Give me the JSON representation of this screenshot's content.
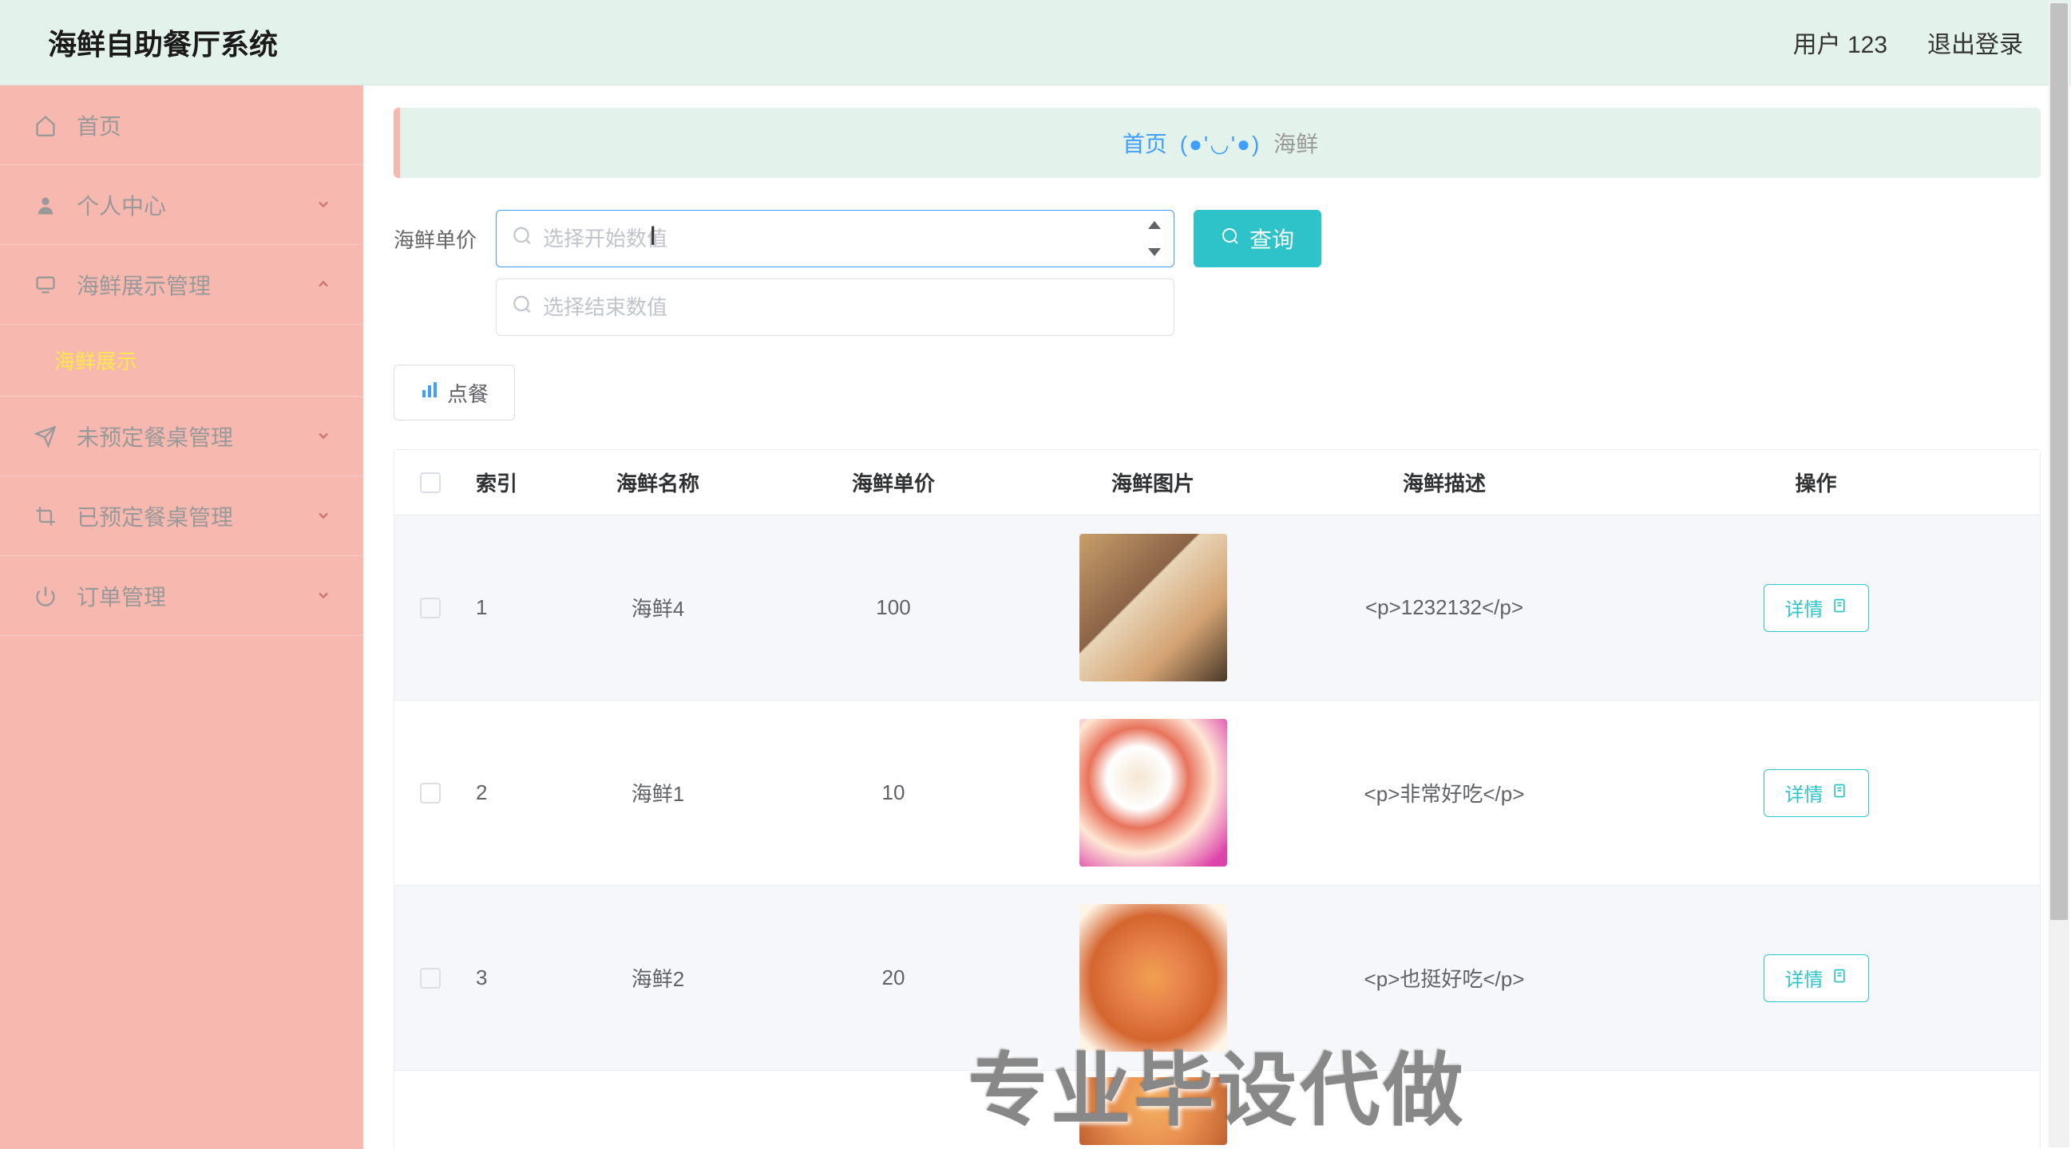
{
  "header": {
    "title": "海鲜自助餐厅系统",
    "user_label": "用户 123",
    "logout_label": "退出登录"
  },
  "sidebar": {
    "items": [
      {
        "label": "首页",
        "icon": "home-icon",
        "expandable": false
      },
      {
        "label": "个人中心",
        "icon": "user-icon",
        "expandable": true
      },
      {
        "label": "海鲜展示管理",
        "icon": "display-icon",
        "expandable": true,
        "expanded": true
      },
      {
        "label": "未预定餐桌管理",
        "icon": "plane-icon",
        "expandable": true
      },
      {
        "label": "已预定餐桌管理",
        "icon": "crop-icon",
        "expandable": true
      },
      {
        "label": "订单管理",
        "icon": "power-icon",
        "expandable": true
      }
    ],
    "sub_item": "海鲜展示"
  },
  "breadcrumb": {
    "home": "首页",
    "sep": "(●'◡'●)",
    "current": "海鲜"
  },
  "search": {
    "label": "海鲜单价",
    "start_placeholder": "选择开始数值",
    "end_placeholder": "选择结束数值",
    "query_label": "查询"
  },
  "actions": {
    "order_label": "点餐"
  },
  "table": {
    "headers": {
      "idx": "索引",
      "name": "海鲜名称",
      "price": "海鲜单价",
      "img": "海鲜图片",
      "desc": "海鲜描述",
      "op": "操作"
    },
    "detail_label": "详情",
    "rows": [
      {
        "idx": "1",
        "name": "海鲜4",
        "price": "100",
        "desc": "<p>1232132</p>"
      },
      {
        "idx": "2",
        "name": "海鲜1",
        "price": "10",
        "desc": "<p>非常好吃</p>"
      },
      {
        "idx": "3",
        "name": "海鲜2",
        "price": "20",
        "desc": "<p>也挺好吃</p>"
      }
    ]
  },
  "watermark": "专业毕设代做"
}
